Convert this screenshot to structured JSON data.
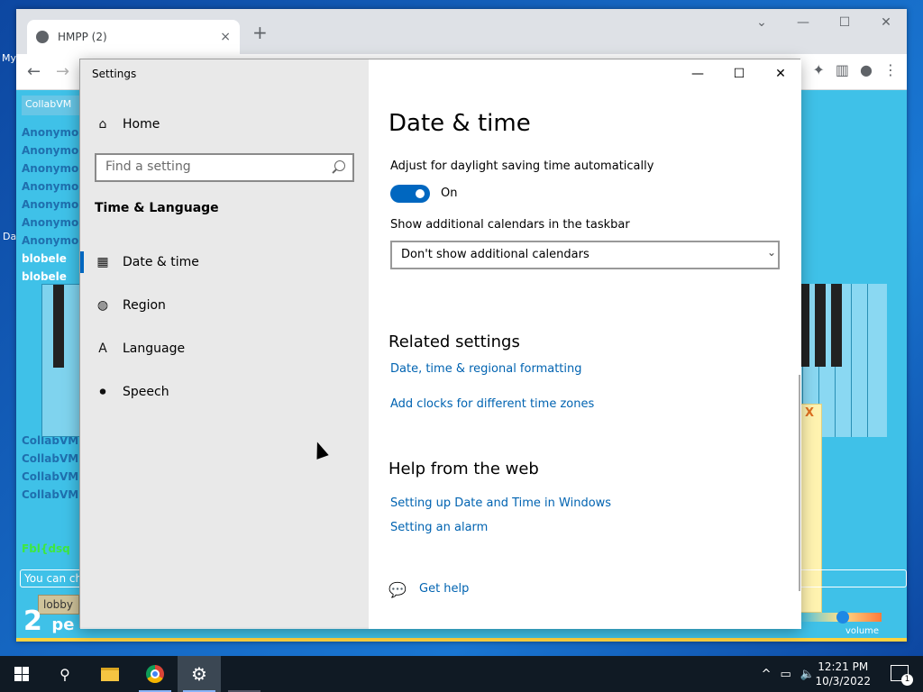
{
  "browser": {
    "tab_title": "HMPP (2)",
    "tab_close": "×",
    "new_tab": "+"
  },
  "site": {
    "header": "CollabVM",
    "chat_lines": [
      {
        "text": "Anonymous",
        "color": "#1f6fae"
      },
      {
        "text": "Anonymous",
        "color": "#1f6fae"
      },
      {
        "text": "Anonymous",
        "color": "#1f6fae"
      },
      {
        "text": "Anonymous",
        "color": "#1f6fae"
      },
      {
        "text": "Anonymous",
        "color": "#1f6fae"
      },
      {
        "text": "Anonymous",
        "color": "#1f6fae"
      },
      {
        "text": "Anonymous",
        "color": "#1f6fae"
      },
      {
        "text": "blobele",
        "color": "#ffffff"
      },
      {
        "text": "blobele",
        "color": "#ffffff"
      }
    ],
    "chat_lines_lower": [
      {
        "text": "CollabVM",
        "color": "#1f6fae"
      },
      {
        "text": "CollabVM",
        "color": "#1f6fae"
      },
      {
        "text": "CollabVM",
        "color": "#1f6fae"
      },
      {
        "text": "CollabVM",
        "color": "#1f6fae"
      },
      {
        "text": "Fbl{dsq",
        "color": "#3ee83e"
      }
    ],
    "chat_input_placeholder": "You can ch",
    "lobby": "lobby",
    "people_count": "2",
    "people_text": "pe",
    "volume": "volume",
    "yellow_close": "X"
  },
  "settings": {
    "window_title": "Settings",
    "nav": {
      "home": "Home",
      "search_placeholder": "Find a setting",
      "section": "Time & Language",
      "items": [
        {
          "label": "Date & time",
          "icon": "calendar-clock-icon"
        },
        {
          "label": "Region",
          "icon": "globe-icon"
        },
        {
          "label": "Language",
          "icon": "language-icon"
        },
        {
          "label": "Speech",
          "icon": "microphone-icon"
        }
      ]
    },
    "page": {
      "title": "Date & time",
      "dst_label": "Adjust for daylight saving time automatically",
      "dst_state": "On",
      "calendars_label": "Show additional calendars in the taskbar",
      "calendars_value": "Don't show additional calendars",
      "related_heading": "Related settings",
      "related_links": [
        "Date, time & regional formatting",
        "Add clocks for different time zones"
      ],
      "help_heading": "Help from the web",
      "help_links": [
        "Setting up Date and Time in Windows",
        "Setting an alarm"
      ],
      "get_help": "Get help"
    }
  },
  "taskbar": {
    "time": "12:21 PM",
    "date": "10/3/2022",
    "notification_count": "1"
  },
  "colors": {
    "accent": "#0067c0",
    "link": "#0063b1"
  }
}
